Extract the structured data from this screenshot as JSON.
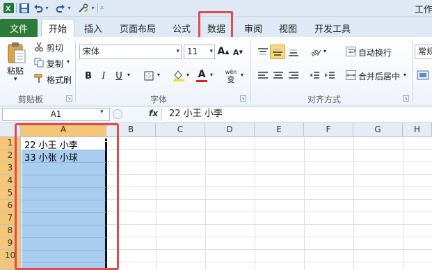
{
  "title_bar": {
    "title": "工作",
    "qat": [
      {
        "icon": "save-icon"
      },
      {
        "icon": "undo-icon"
      },
      {
        "icon": "redo-icon"
      },
      {
        "icon": "tools-icon"
      },
      {
        "icon": "customize-icon"
      }
    ]
  },
  "ribbon_tabs": [
    "文件",
    "开始",
    "插入",
    "页面布局",
    "公式",
    "数据",
    "审阅",
    "视图",
    "开发工具"
  ],
  "active_tab": "开始",
  "highlighted_tab": "数据",
  "clipboard": {
    "paste": "粘贴",
    "cut": "剪切",
    "copy": "复制",
    "format_painter": "格式刷",
    "label": "剪贴板"
  },
  "font": {
    "name": "宋体",
    "size": "11",
    "grow": "A",
    "shrink": "A",
    "bold": "B",
    "italic": "I",
    "underline": "U",
    "font_color_letter": "A",
    "label": "字体",
    "wen": "wén",
    "wen_char": "变"
  },
  "alignment": {
    "wrap_text": "自动换行",
    "merge_center": "合并后居中",
    "label": "对齐方式"
  },
  "number": {
    "format": "常规"
  },
  "formula_bar": {
    "name_box": "A1",
    "fx": "fx",
    "content": "22 小王 小李"
  },
  "columns": [
    "A",
    "B",
    "C",
    "D",
    "E",
    "F",
    "G",
    "H"
  ],
  "selected_column": "A",
  "rows": [
    "1",
    "2",
    "3",
    "4",
    "5",
    "6",
    "7",
    "8",
    "9",
    "10"
  ],
  "cells": [
    {
      "ref": "A1",
      "value": "22 小王 小李"
    },
    {
      "ref": "A2",
      "value": "33 小张 小球"
    }
  ],
  "colors": {
    "file_tab": "#2d7a3a",
    "selection": "#a8cdee",
    "highlight_box": "#e0494e",
    "header_selected": "#f5c676"
  }
}
